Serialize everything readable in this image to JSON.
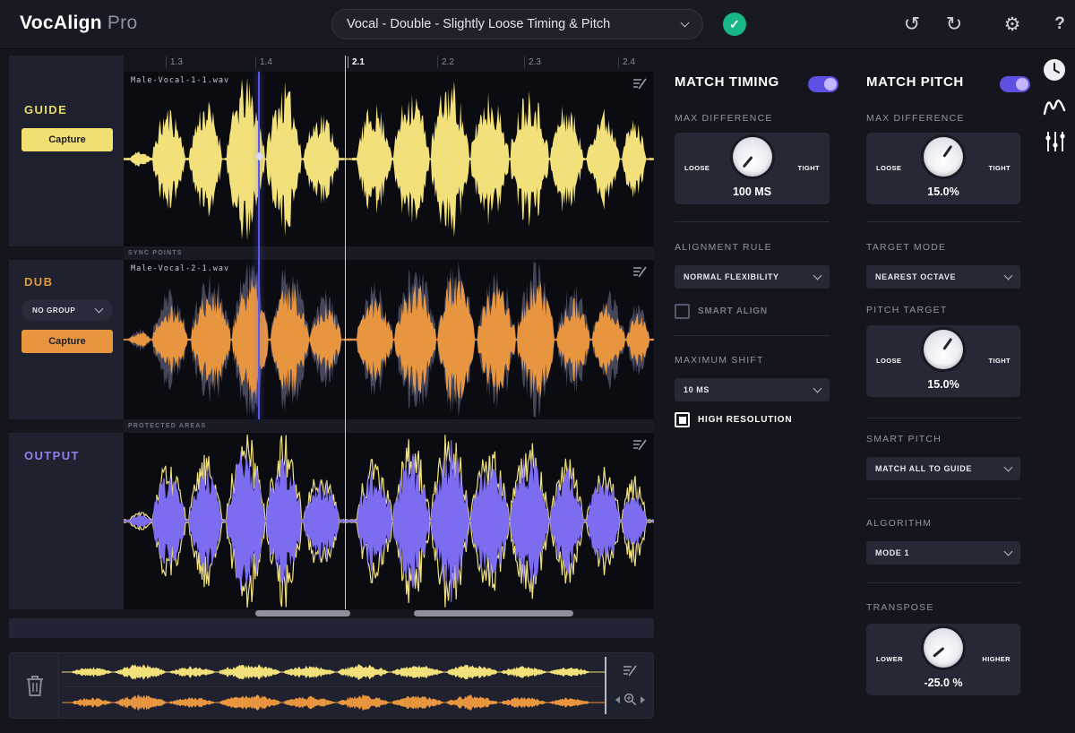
{
  "app": {
    "brand": "VocAlign",
    "brand_suffix": "Pro"
  },
  "topbar": {
    "preset": "Vocal - Double - Slightly Loose Timing & Pitch"
  },
  "ruler": {
    "ticks": [
      "1.3",
      "1.4",
      "2.1",
      "2.2",
      "2.3",
      "2.4"
    ]
  },
  "guide": {
    "label": "GUIDE",
    "capture": "Capture",
    "file": "Male-Vocal-1-1.wav"
  },
  "dub": {
    "label": "DUB",
    "group": "NO GROUP",
    "capture": "Capture",
    "file": "Male-Vocal-2-1.wav"
  },
  "output": {
    "label": "OUTPUT"
  },
  "strips": {
    "sync": "SYNC POINTS",
    "protected": "PROTECTED AREAS"
  },
  "timing": {
    "title": "MATCH TIMING",
    "max_difference": "MAX DIFFERENCE",
    "knob": {
      "left": "LOOSE",
      "right": "TIGHT",
      "value": "100 MS"
    },
    "alignment_rule_label": "ALIGNMENT RULE",
    "alignment_rule_value": "NORMAL FLEXIBILITY",
    "smart_align": "SMART ALIGN",
    "maximum_shift_label": "MAXIMUM SHIFT",
    "maximum_shift_value": "10 MS",
    "high_resolution": "HIGH RESOLUTION"
  },
  "pitch": {
    "title": "MATCH PITCH",
    "max_difference": "MAX DIFFERENCE",
    "knob": {
      "left": "LOOSE",
      "right": "TIGHT",
      "value": "15.0%"
    },
    "target_mode_label": "TARGET MODE",
    "target_mode_value": "NEAREST OCTAVE",
    "pitch_target_label": "PITCH TARGET",
    "pitch_target_knob": {
      "left": "LOOSE",
      "right": "TIGHT",
      "value": "15.0%"
    },
    "smart_pitch_label": "SMART PITCH",
    "smart_pitch_value": "MATCH ALL TO GUIDE",
    "algorithm_label": "ALGORITHM",
    "algorithm_value": "MODE 1",
    "transpose_label": "TRANSPOSE",
    "transpose_knob": {
      "left": "LOWER",
      "right": "HIGHER",
      "value": "-25.0 %"
    }
  },
  "colors": {
    "guide_yellow": "#f2e17a",
    "dub_orange": "#e8953f",
    "output_purple": "#7b6cf0",
    "toggle_purple": "#5e50e0",
    "confirm_green": "#17b687"
  }
}
